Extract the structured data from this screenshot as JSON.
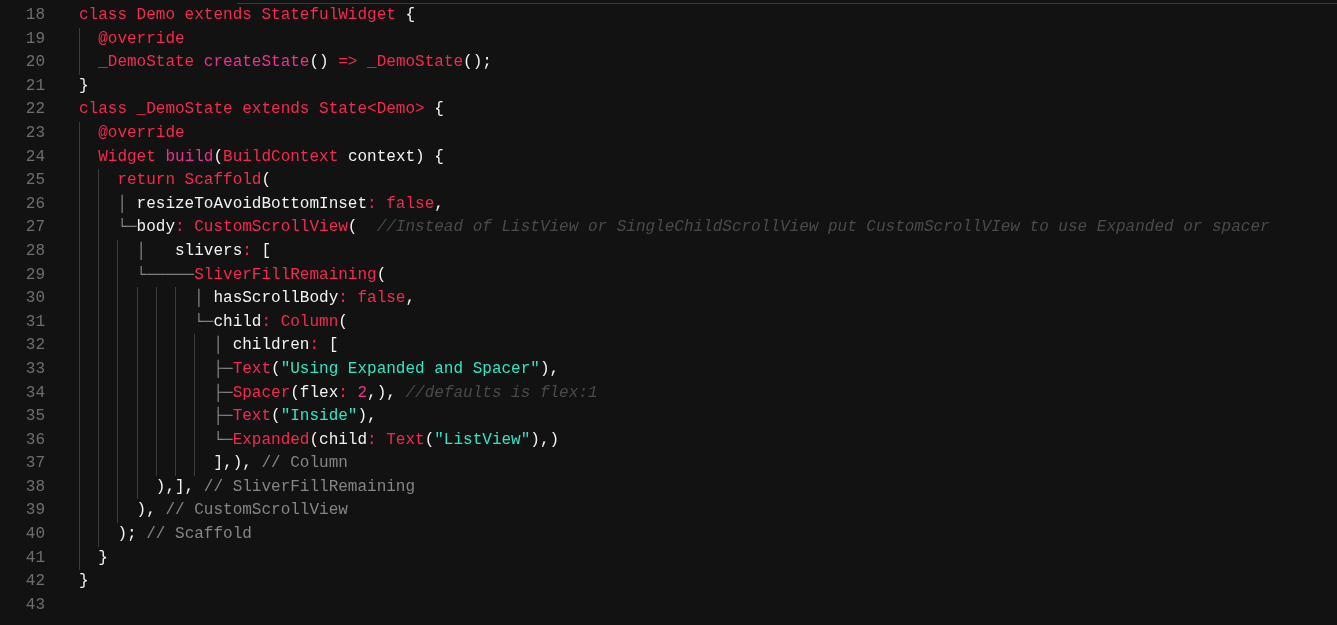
{
  "lines": [
    {
      "number": "18",
      "tokens": [
        {
          "kind": "keyword",
          "text": "class Demo extends StatefulWidget "
        },
        {
          "kind": "plain",
          "text": "{"
        }
      ]
    },
    {
      "number": "19",
      "tokens": [
        {
          "kind": "keyword",
          "text": "  @override"
        }
      ]
    },
    {
      "number": "20",
      "tokens": [
        {
          "kind": "keyword",
          "text": "  _DemoState "
        },
        {
          "kind": "function",
          "text": "createState"
        },
        {
          "kind": "plain",
          "text": "() "
        },
        {
          "kind": "keyword",
          "text": "=> _DemoState"
        },
        {
          "kind": "plain",
          "text": "();"
        }
      ]
    },
    {
      "number": "21",
      "tokens": [
        {
          "kind": "plain",
          "text": "}"
        }
      ]
    },
    {
      "number": "22",
      "tokens": [
        {
          "kind": "keyword",
          "text": "class _DemoState extends State<Demo> "
        },
        {
          "kind": "plain",
          "text": "{"
        }
      ]
    },
    {
      "number": "23",
      "tokens": [
        {
          "kind": "keyword",
          "text": "  @override"
        }
      ]
    },
    {
      "number": "24",
      "tokens": [
        {
          "kind": "keyword",
          "text": "  Widget "
        },
        {
          "kind": "function",
          "text": "build"
        },
        {
          "kind": "plain",
          "text": "("
        },
        {
          "kind": "keyword",
          "text": "BuildContext "
        },
        {
          "kind": "plain",
          "text": "context) {"
        }
      ]
    },
    {
      "number": "25",
      "tokens": [
        {
          "kind": "keyword",
          "text": "    return Scaffold"
        },
        {
          "kind": "plain",
          "text": "("
        }
      ]
    },
    {
      "number": "26",
      "tokens": [
        {
          "kind": "guide",
          "text": "    │ "
        },
        {
          "kind": "plain",
          "text": "resizeToAvoidBottomInset"
        },
        {
          "kind": "keyword",
          "text": ": false"
        },
        {
          "kind": "plain",
          "text": ","
        }
      ]
    },
    {
      "number": "27",
      "tokens": [
        {
          "kind": "guide",
          "text": "    └─"
        },
        {
          "kind": "plain",
          "text": "body"
        },
        {
          "kind": "keyword",
          "text": ": CustomScrollView"
        },
        {
          "kind": "plain",
          "text": "(  "
        },
        {
          "kind": "doc_comment",
          "text": "//Instead of ListView or SingleChildScrollView put CustomScrollVIew to use Expanded or spacer"
        }
      ]
    },
    {
      "number": "28",
      "tokens": [
        {
          "kind": "guide",
          "text": "      │   "
        },
        {
          "kind": "plain",
          "text": "slivers"
        },
        {
          "kind": "keyword",
          "text": ": "
        },
        {
          "kind": "plain",
          "text": "["
        }
      ]
    },
    {
      "number": "29",
      "tokens": [
        {
          "kind": "guide",
          "text": "      └─────"
        },
        {
          "kind": "keyword",
          "text": "SliverFillRemaining"
        },
        {
          "kind": "plain",
          "text": "("
        }
      ]
    },
    {
      "number": "30",
      "tokens": [
        {
          "kind": "guide",
          "text": "            │ "
        },
        {
          "kind": "plain",
          "text": "hasScrollBody"
        },
        {
          "kind": "keyword",
          "text": ": false"
        },
        {
          "kind": "plain",
          "text": ","
        }
      ]
    },
    {
      "number": "31",
      "tokens": [
        {
          "kind": "guide",
          "text": "            └─"
        },
        {
          "kind": "plain",
          "text": "child"
        },
        {
          "kind": "keyword",
          "text": ": Column"
        },
        {
          "kind": "plain",
          "text": "("
        }
      ]
    },
    {
      "number": "32",
      "tokens": [
        {
          "kind": "guide",
          "text": "              │ "
        },
        {
          "kind": "plain",
          "text": "children"
        },
        {
          "kind": "keyword",
          "text": ": "
        },
        {
          "kind": "plain",
          "text": "["
        }
      ]
    },
    {
      "number": "33",
      "tokens": [
        {
          "kind": "guide",
          "text": "              ├─"
        },
        {
          "kind": "keyword",
          "text": "Text"
        },
        {
          "kind": "plain",
          "text": "("
        },
        {
          "kind": "string",
          "text": "\"Using Expanded and Spacer\""
        },
        {
          "kind": "plain",
          "text": "),"
        }
      ]
    },
    {
      "number": "34",
      "tokens": [
        {
          "kind": "guide",
          "text": "              ├─"
        },
        {
          "kind": "keyword",
          "text": "Spacer"
        },
        {
          "kind": "plain",
          "text": "(flex"
        },
        {
          "kind": "keyword",
          "text": ": "
        },
        {
          "kind": "function",
          "text": "2"
        },
        {
          "kind": "plain",
          "text": ",), "
        },
        {
          "kind": "doc_comment",
          "text": "//defaults is flex:1"
        }
      ]
    },
    {
      "number": "35",
      "tokens": [
        {
          "kind": "guide",
          "text": "              ├─"
        },
        {
          "kind": "keyword",
          "text": "Text"
        },
        {
          "kind": "plain",
          "text": "("
        },
        {
          "kind": "string",
          "text": "\"Inside\""
        },
        {
          "kind": "plain",
          "text": "),"
        }
      ]
    },
    {
      "number": "36",
      "tokens": [
        {
          "kind": "guide",
          "text": "              └─"
        },
        {
          "kind": "keyword",
          "text": "Expanded"
        },
        {
          "kind": "plain",
          "text": "(child"
        },
        {
          "kind": "keyword",
          "text": ": Text"
        },
        {
          "kind": "plain",
          "text": "("
        },
        {
          "kind": "string",
          "text": "\"ListView\""
        },
        {
          "kind": "plain",
          "text": "),)"
        }
      ]
    },
    {
      "number": "37",
      "tokens": [
        {
          "kind": "plain",
          "text": "              ],), "
        },
        {
          "kind": "comment",
          "text": "// Column"
        }
      ]
    },
    {
      "number": "38",
      "tokens": [
        {
          "kind": "plain",
          "text": "        ),], "
        },
        {
          "kind": "comment",
          "text": "// SliverFillRemaining"
        }
      ]
    },
    {
      "number": "39",
      "tokens": [
        {
          "kind": "plain",
          "text": "      ), "
        },
        {
          "kind": "comment",
          "text": "// CustomScrollView"
        }
      ]
    },
    {
      "number": "40",
      "tokens": [
        {
          "kind": "plain",
          "text": "    ); "
        },
        {
          "kind": "comment",
          "text": "// Scaffold"
        }
      ]
    },
    {
      "number": "41",
      "tokens": [
        {
          "kind": "plain",
          "text": "  }"
        }
      ]
    },
    {
      "number": "42",
      "tokens": [
        {
          "kind": "plain",
          "text": "}"
        }
      ]
    },
    {
      "number": "43"
    }
  ]
}
